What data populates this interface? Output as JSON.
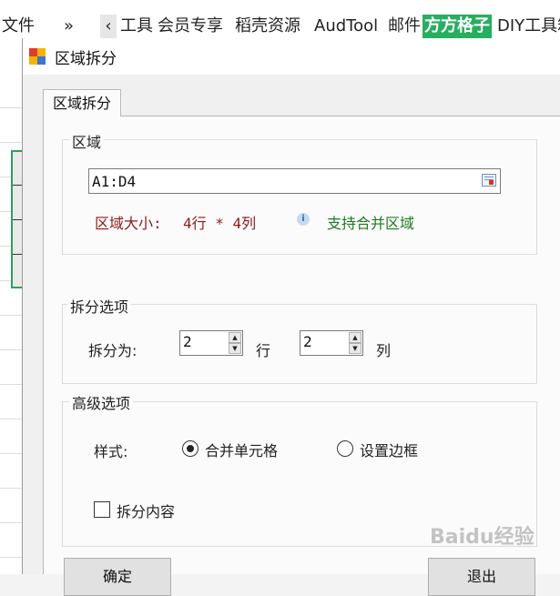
{
  "ribbon": {
    "file": "文件",
    "more": "»",
    "scroll_left": "‹",
    "tabs": [
      "工具",
      "会员专享",
      "稻壳资源",
      "AudTool",
      "邮件",
      "方方格子",
      "DIY工具箱"
    ],
    "active_tab": "方方格子",
    "active_color": "#27ae60"
  },
  "dialog": {
    "title": "区域拆分",
    "tab_label": "区域拆分",
    "region": {
      "group_label": "区域",
      "value": "A1:D4",
      "size_label": "区域大小:",
      "size_value": "4行 * 4列",
      "support_text": "支持合并区域",
      "size_color": "#8b1a1a",
      "support_color": "#1f7a1f"
    },
    "split": {
      "group_label": "拆分选项",
      "split_as_label": "拆分为:",
      "rows_value": "2",
      "rows_unit": "行",
      "cols_value": "2",
      "cols_unit": "列"
    },
    "advanced": {
      "group_label": "高级选项",
      "style_label": "样式:",
      "option_merge": "合并单元格",
      "option_border": "设置边框",
      "selected": "合并单元格",
      "split_content_label": "拆分内容",
      "split_content_checked": false
    },
    "buttons": {
      "ok": "确定",
      "exit": "退出"
    }
  },
  "watermark": "Baidu经验",
  "icons": [
    "app-icon",
    "range-picker-icon",
    "info-icon",
    "spin-up-icon",
    "spin-down-icon"
  ]
}
